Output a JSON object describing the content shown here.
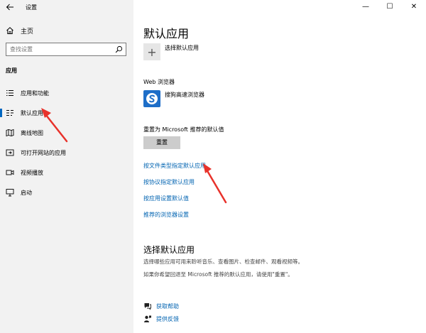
{
  "window": {
    "title": "设置",
    "minimize": "—",
    "maximize": "☐",
    "close": "✕"
  },
  "sidebar": {
    "back_icon": "arrow-left-icon",
    "home_label": "主页",
    "search_placeholder": "查找设置",
    "section_label": "应用",
    "items": [
      {
        "label": "应用和功能",
        "icon": "list-icon"
      },
      {
        "label": "默认应用",
        "icon": "default-apps-icon",
        "active": true
      },
      {
        "label": "离线地图",
        "icon": "map-icon"
      },
      {
        "label": "可打开网站的应用",
        "icon": "open-website-icon"
      },
      {
        "label": "视频播放",
        "icon": "video-icon"
      },
      {
        "label": "启动",
        "icon": "startup-icon"
      }
    ]
  },
  "main": {
    "title": "默认应用",
    "pick_default_label": "选择默认应用",
    "web_browser_label": "Web 浏览器",
    "browser_name": "搜狗高速浏览器",
    "reset_label": "重置为 Microsoft 推荐的默认值",
    "reset_button": "重置",
    "links": [
      "按文件类型指定默认应用",
      "按协议指定默认应用",
      "按应用设置默认值",
      "推荐的浏览器设置"
    ],
    "section2_title": "选择默认应用",
    "section2_desc": "选择哪些应用可用来聆听音乐、查看图片、检查邮件、观看视频等。",
    "section2_note": "如果你希望回退至 Microsoft 推荐的默认应用，请使用\"重置\"。",
    "help_link": "获取帮助",
    "feedback_link": "提供反馈"
  },
  "colors": {
    "sidebar_bg": "#f2f2f2",
    "link": "#0063b1",
    "accent": "#0067c0",
    "annotation": "#e8322b"
  }
}
